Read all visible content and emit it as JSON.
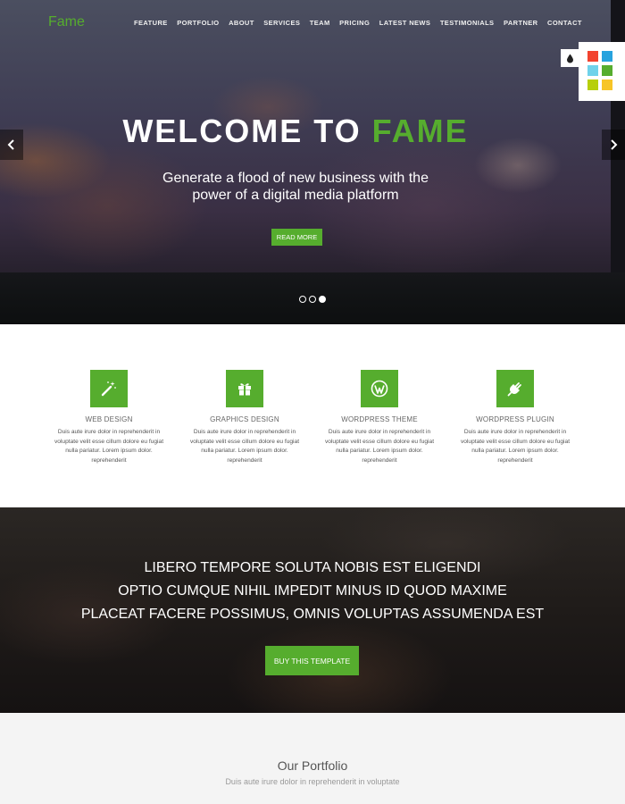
{
  "header": {
    "logo": "Fame",
    "nav": [
      "FEATURE",
      "PORTFOLIO",
      "ABOUT",
      "SERVICES",
      "TEAM",
      "PRICING",
      "LATEST NEWS",
      "TESTIMONIALS",
      "PARTNER",
      "CONTACT"
    ]
  },
  "style_switcher": {
    "icon": "droplet-icon",
    "colors": [
      "#f2432f",
      "#27a3de",
      "#6fd2ea",
      "#56ad2e",
      "#b7cf0b",
      "#f7c527"
    ]
  },
  "hero": {
    "title_part1": "WELCOME TO",
    "title_part2": "FAME",
    "subtitle_line1": "Generate a flood of new business with the",
    "subtitle_line2": "power of a digital media platform",
    "button": "READ MORE",
    "slides": 3,
    "active_slide": 3
  },
  "features": [
    {
      "icon": "magic-wand-icon",
      "title": "WEB DESIGN",
      "lines": [
        "Duis aute irure dolor in reprehenderit in",
        "voluptate velit esse cillum dolore eu fugiat",
        "nulla pariatur. Lorem ipsum dolor.",
        "reprehenderit"
      ]
    },
    {
      "icon": "gift-icon",
      "title": "GRAPHICS DESIGN",
      "lines": [
        "Duis aute irure dolor in reprehenderit in",
        "voluptate velit esse cillum dolore eu fugiat",
        "nulla pariatur. Lorem ipsum dolor.",
        "reprehenderit"
      ]
    },
    {
      "icon": "wordpress-icon",
      "title": "WORDPRESS THEME",
      "lines": [
        "Duis aute irure dolor in reprehenderit in",
        "voluptate velit esse cillum dolore eu fugiat",
        "nulla pariatur. Lorem ipsum dolor.",
        "reprehenderit"
      ]
    },
    {
      "icon": "plug-icon",
      "title": "WORDPRESS PLUGIN",
      "lines": [
        "Duis aute irure dolor in reprehenderit in",
        "voluptate velit esse cillum dolore eu fugiat",
        "nulla pariatur. Lorem ipsum dolor.",
        "reprehenderit"
      ]
    }
  ],
  "promo": {
    "lines": [
      "LIBERO TEMPORE SOLUTA NOBIS EST ELIGENDI",
      "OPTIO CUMQUE NIHIL IMPEDIT MINUS ID QUOD MAXIME",
      "PLACEAT FACERE POSSIMUS, OMNIS VOLUPTAS ASSUMENDA EST"
    ],
    "button": "BUY THIS TEMPLATE"
  },
  "portfolio": {
    "title": "Our Portfolio",
    "subtitle": "Duis aute irure dolor in reprehenderit in voluptate"
  },
  "colors": {
    "accent": "#56ad2e"
  }
}
